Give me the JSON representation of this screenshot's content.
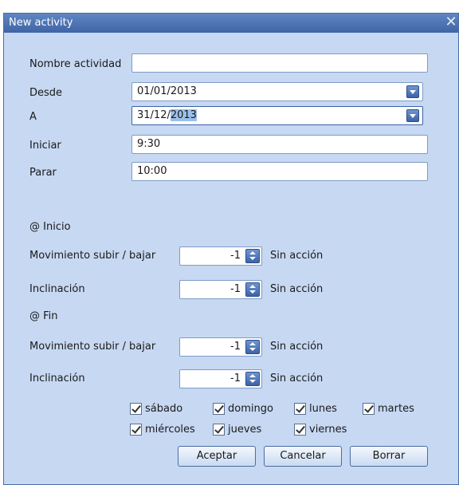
{
  "window": {
    "title": "New activity",
    "close_icon": "close-icon"
  },
  "form": {
    "nombre_label": "Nombre actividad",
    "nombre_value": "",
    "desde_label": "Desde",
    "desde_value": "01/01/2013",
    "a_label": "A",
    "a_value_prefix": "31/12/",
    "a_value_selected": "2013",
    "iniciar_label": "Iniciar",
    "iniciar_value": "9:30",
    "parar_label": "Parar",
    "parar_value": "10:00"
  },
  "inicio": {
    "header": "@ Inicio",
    "mov_label": "Movimiento subir / bajar",
    "mov_value": "-1",
    "mov_status": "Sin acción",
    "incl_label": "Inclinación",
    "incl_value": "-1",
    "incl_status": "Sin acción"
  },
  "fin": {
    "header": "@ Fin",
    "mov_label": "Movimiento subir / bajar",
    "mov_value": "-1",
    "mov_status": "Sin acción",
    "incl_label": "Inclinación",
    "incl_value": "-1",
    "incl_status": "Sin acción"
  },
  "days": {
    "sabado": "sábado",
    "domingo": "domingo",
    "lunes": "lunes",
    "martes": "martes",
    "miercoles": "miércoles",
    "jueves": "jueves",
    "viernes": "viernes"
  },
  "buttons": {
    "aceptar": "Aceptar",
    "cancelar": "Cancelar",
    "borrar": "Borrar"
  },
  "colors": {
    "title_bar": "#4f75b6",
    "background": "#c7d8f2",
    "selection": "#9cc0ea"
  }
}
